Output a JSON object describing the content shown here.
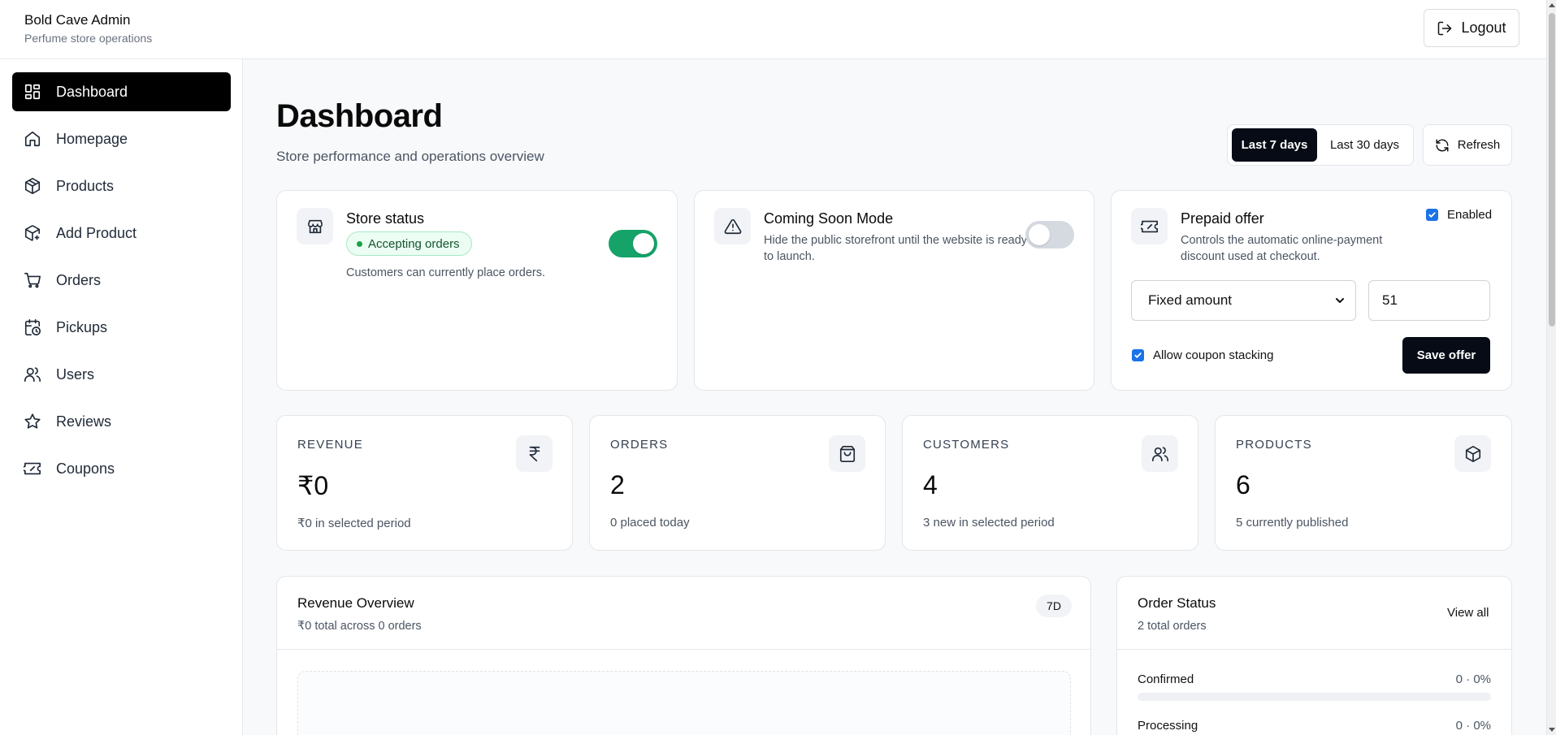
{
  "app": {
    "title": "Bold Cave Admin",
    "subtitle": "Perfume store operations",
    "logout_label": "Logout"
  },
  "sidebar": {
    "items": [
      {
        "label": "Dashboard",
        "icon": "dashboard-icon",
        "active": true
      },
      {
        "label": "Homepage",
        "icon": "home-icon"
      },
      {
        "label": "Products",
        "icon": "package-icon"
      },
      {
        "label": "Add Product",
        "icon": "package-plus-icon"
      },
      {
        "label": "Orders",
        "icon": "cart-icon"
      },
      {
        "label": "Pickups",
        "icon": "calendar-clock-icon"
      },
      {
        "label": "Users",
        "icon": "users-icon"
      },
      {
        "label": "Reviews",
        "icon": "star-icon"
      },
      {
        "label": "Coupons",
        "icon": "ticket-icon"
      }
    ]
  },
  "header": {
    "title": "Dashboard",
    "subtitle": "Store performance and operations overview",
    "ranges": [
      "Last 7 days",
      "Last 30 days"
    ],
    "selected_range": "Last 7 days",
    "refresh_label": "Refresh"
  },
  "store_status": {
    "title": "Store status",
    "badge": "Accepting orders",
    "description": "Customers can currently place orders.",
    "enabled": true
  },
  "coming_soon": {
    "title": "Coming Soon Mode",
    "description": "Hide the public storefront until the website is ready to launch.",
    "enabled": false
  },
  "prepaid_offer": {
    "title": "Prepaid offer",
    "description": "Controls the automatic online-payment discount used at checkout.",
    "enabled_label": "Enabled",
    "enabled": true,
    "discount_type": "Fixed amount",
    "amount": "51",
    "stacking_label": "Allow coupon stacking",
    "stacking": true,
    "save_label": "Save offer"
  },
  "stats": [
    {
      "label": "REVENUE",
      "value": "₹0",
      "sub": "₹0 in selected period",
      "icon": "rupee-icon"
    },
    {
      "label": "ORDERS",
      "value": "2",
      "sub": "0 placed today",
      "icon": "shopping-bag-icon"
    },
    {
      "label": "CUSTOMERS",
      "value": "4",
      "sub": "3 new in selected period",
      "icon": "users-icon"
    },
    {
      "label": "PRODUCTS",
      "value": "6",
      "sub": "5 currently published",
      "icon": "box-icon"
    }
  ],
  "revenue_overview": {
    "title": "Revenue Overview",
    "subtitle": "₹0 total across 0 orders",
    "chip": "7D"
  },
  "order_status": {
    "title": "Order Status",
    "subtitle": "2 total orders",
    "view_all": "View all",
    "rows": [
      {
        "name": "Confirmed",
        "value": "0 · 0%",
        "fraction": 0
      },
      {
        "name": "Processing",
        "value": "0 · 0%",
        "fraction": 0
      }
    ]
  },
  "colors": {
    "accent_dark": "#060b16",
    "success": "#16a36a",
    "checkbox": "#1a73e8"
  }
}
